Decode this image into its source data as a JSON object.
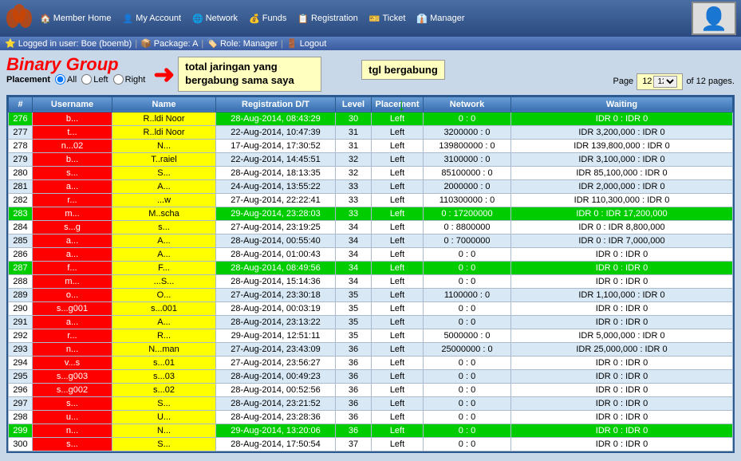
{
  "nav": {
    "items": [
      {
        "label": "Member Home",
        "icon": "🏠"
      },
      {
        "label": "My Account",
        "icon": "👤"
      },
      {
        "label": "Network",
        "icon": "🌐"
      },
      {
        "label": "Funds",
        "icon": "💰"
      },
      {
        "label": "Registration",
        "icon": "📋"
      },
      {
        "label": "Ticket",
        "icon": "🎫"
      },
      {
        "label": "Manager",
        "icon": "👔"
      }
    ],
    "subnav": [
      {
        "label": "Logged in user: Boe (boemb)",
        "icon": "⭐"
      },
      {
        "label": "Package: A",
        "icon": "📦"
      },
      {
        "label": "Role: Manager",
        "icon": "🏷️"
      },
      {
        "label": "Logout",
        "icon": "🚪"
      }
    ]
  },
  "page": {
    "title": "Binary Group",
    "tooltip1": "total jaringan yang bergabung sama saya",
    "tooltip2": "tgl bergabung",
    "placement_label": "Placement",
    "placement_options": [
      "All",
      "Left",
      "Right"
    ],
    "page_current": "12",
    "page_total": "12",
    "page_label": "Page",
    "pages_label": "of 12 pages."
  },
  "table": {
    "headers": [
      "#",
      "Username",
      "Name",
      "Registration D/T",
      "Level",
      "Placement",
      "Network",
      "Waiting"
    ],
    "rows": [
      {
        "num": "276",
        "username": "b...",
        "name": "R..ldi Noor",
        "dt": "28-Aug-2014, 08:43:29",
        "level": "30",
        "placement": "Left",
        "network": "0 : 0",
        "waiting": "IDR 0 : IDR 0",
        "row_class": "row-green"
      },
      {
        "num": "277",
        "username": "t...",
        "name": "R..ldi Noor",
        "dt": "22-Aug-2014, 10:47:39",
        "level": "31",
        "placement": "Left",
        "network": "3200000 : 0",
        "waiting": "IDR 3,200,000 : IDR 0",
        "row_class": "row-white"
      },
      {
        "num": "278",
        "username": "n...02",
        "name": "N...",
        "dt": "17-Aug-2014, 17:30:52",
        "level": "31",
        "placement": "Left",
        "network": "139800000 : 0",
        "waiting": "IDR 139,800,000 : IDR 0",
        "row_class": "row-light"
      },
      {
        "num": "279",
        "username": "b...",
        "name": "T..raiel",
        "dt": "22-Aug-2014, 14:45:51",
        "level": "32",
        "placement": "Left",
        "network": "3100000 : 0",
        "waiting": "IDR 3,100,000 : IDR 0",
        "row_class": "row-white"
      },
      {
        "num": "280",
        "username": "s...",
        "name": "S...",
        "dt": "28-Aug-2014, 18:13:35",
        "level": "32",
        "placement": "Left",
        "network": "85100000 : 0",
        "waiting": "IDR 85,100,000 : IDR 0",
        "row_class": "row-light"
      },
      {
        "num": "281",
        "username": "a...",
        "name": "A...",
        "dt": "24-Aug-2014, 13:55:22",
        "level": "33",
        "placement": "Left",
        "network": "2000000 : 0",
        "waiting": "IDR 2,000,000 : IDR 0",
        "row_class": "row-white"
      },
      {
        "num": "282",
        "username": "r...",
        "name": "...w",
        "dt": "27-Aug-2014, 22:22:41",
        "level": "33",
        "placement": "Left",
        "network": "110300000 : 0",
        "waiting": "IDR 110,300,000 : IDR 0",
        "row_class": "row-light"
      },
      {
        "num": "283",
        "username": "m...",
        "name": "M..scha",
        "dt": "29-Aug-2014, 23:28:03",
        "level": "33",
        "placement": "Left",
        "network": "0 : 17200000",
        "waiting": "IDR 0 : IDR 17,200,000",
        "row_class": "row-green"
      },
      {
        "num": "284",
        "username": "s...g",
        "name": "s...",
        "dt": "27-Aug-2014, 23:19:25",
        "level": "34",
        "placement": "Left",
        "network": "0 : 8800000",
        "waiting": "IDR 0 : IDR 8,800,000",
        "row_class": "row-white"
      },
      {
        "num": "285",
        "username": "a...",
        "name": "A...",
        "dt": "28-Aug-2014, 00:55:40",
        "level": "34",
        "placement": "Left",
        "network": "0 : 7000000",
        "waiting": "IDR 0 : IDR 7,000,000",
        "row_class": "row-light"
      },
      {
        "num": "286",
        "username": "a...",
        "name": "A...",
        "dt": "28-Aug-2014, 01:00:43",
        "level": "34",
        "placement": "Left",
        "network": "0 : 0",
        "waiting": "IDR 0 : IDR 0",
        "row_class": "row-white"
      },
      {
        "num": "287",
        "username": "f...",
        "name": "F...",
        "dt": "28-Aug-2014, 08:49:56",
        "level": "34",
        "placement": "Left",
        "network": "0 : 0",
        "waiting": "IDR 0 : IDR 0",
        "row_class": "row-green"
      },
      {
        "num": "288",
        "username": "m...",
        "name": "...S...",
        "dt": "28-Aug-2014, 15:14:36",
        "level": "34",
        "placement": "Left",
        "network": "0 : 0",
        "waiting": "IDR 0 : IDR 0",
        "row_class": "row-light"
      },
      {
        "num": "289",
        "username": "o...",
        "name": "O...",
        "dt": "27-Aug-2014, 23:30:18",
        "level": "35",
        "placement": "Left",
        "network": "1100000 : 0",
        "waiting": "IDR 1,100,000 : IDR 0",
        "row_class": "row-white"
      },
      {
        "num": "290",
        "username": "s...g001",
        "name": "s...001",
        "dt": "28-Aug-2014, 00:03:19",
        "level": "35",
        "placement": "Left",
        "network": "0 : 0",
        "waiting": "IDR 0 : IDR 0",
        "row_class": "row-light"
      },
      {
        "num": "291",
        "username": "a...",
        "name": "A...",
        "dt": "28-Aug-2014, 23:13:22",
        "level": "35",
        "placement": "Left",
        "network": "0 : 0",
        "waiting": "IDR 0 : IDR 0",
        "row_class": "row-white"
      },
      {
        "num": "292",
        "username": "r...",
        "name": "R...",
        "dt": "29-Aug-2014, 12:51:11",
        "level": "35",
        "placement": "Left",
        "network": "5000000 : 0",
        "waiting": "IDR 5,000,000 : IDR 0",
        "row_class": "row-light"
      },
      {
        "num": "293",
        "username": "n...",
        "name": "N...man",
        "dt": "27-Aug-2014, 23:43:09",
        "level": "36",
        "placement": "Left",
        "network": "25000000 : 0",
        "waiting": "IDR 25,000,000 : IDR 0",
        "row_class": "row-white"
      },
      {
        "num": "294",
        "username": "v...s",
        "name": "s...01",
        "dt": "27-Aug-2014, 23:56:27",
        "level": "36",
        "placement": "Left",
        "network": "0 : 0",
        "waiting": "IDR 0 : IDR 0",
        "row_class": "row-light"
      },
      {
        "num": "295",
        "username": "s...g003",
        "name": "s...03",
        "dt": "28-Aug-2014, 00:49:23",
        "level": "36",
        "placement": "Left",
        "network": "0 : 0",
        "waiting": "IDR 0 : IDR 0",
        "row_class": "row-white"
      },
      {
        "num": "296",
        "username": "s...g002",
        "name": "s...02",
        "dt": "28-Aug-2014, 00:52:56",
        "level": "36",
        "placement": "Left",
        "network": "0 : 0",
        "waiting": "IDR 0 : IDR 0",
        "row_class": "row-light"
      },
      {
        "num": "297",
        "username": "s...",
        "name": "S...",
        "dt": "28-Aug-2014, 23:21:52",
        "level": "36",
        "placement": "Left",
        "network": "0 : 0",
        "waiting": "IDR 0 : IDR 0",
        "row_class": "row-white"
      },
      {
        "num": "298",
        "username": "u...",
        "name": "U...",
        "dt": "28-Aug-2014, 23:28:36",
        "level": "36",
        "placement": "Left",
        "network": "0 : 0",
        "waiting": "IDR 0 : IDR 0",
        "row_class": "row-light"
      },
      {
        "num": "299",
        "username": "n...",
        "name": "N...",
        "dt": "29-Aug-2014, 13:20:06",
        "level": "36",
        "placement": "Left",
        "network": "0 : 0",
        "waiting": "IDR 0 : IDR 0",
        "row_class": "row-green"
      },
      {
        "num": "300",
        "username": "s...",
        "name": "S...",
        "dt": "28-Aug-2014, 17:50:54",
        "level": "37",
        "placement": "Left",
        "network": "0 : 0",
        "waiting": "IDR 0 : IDR 0",
        "row_class": "row-white"
      }
    ]
  }
}
